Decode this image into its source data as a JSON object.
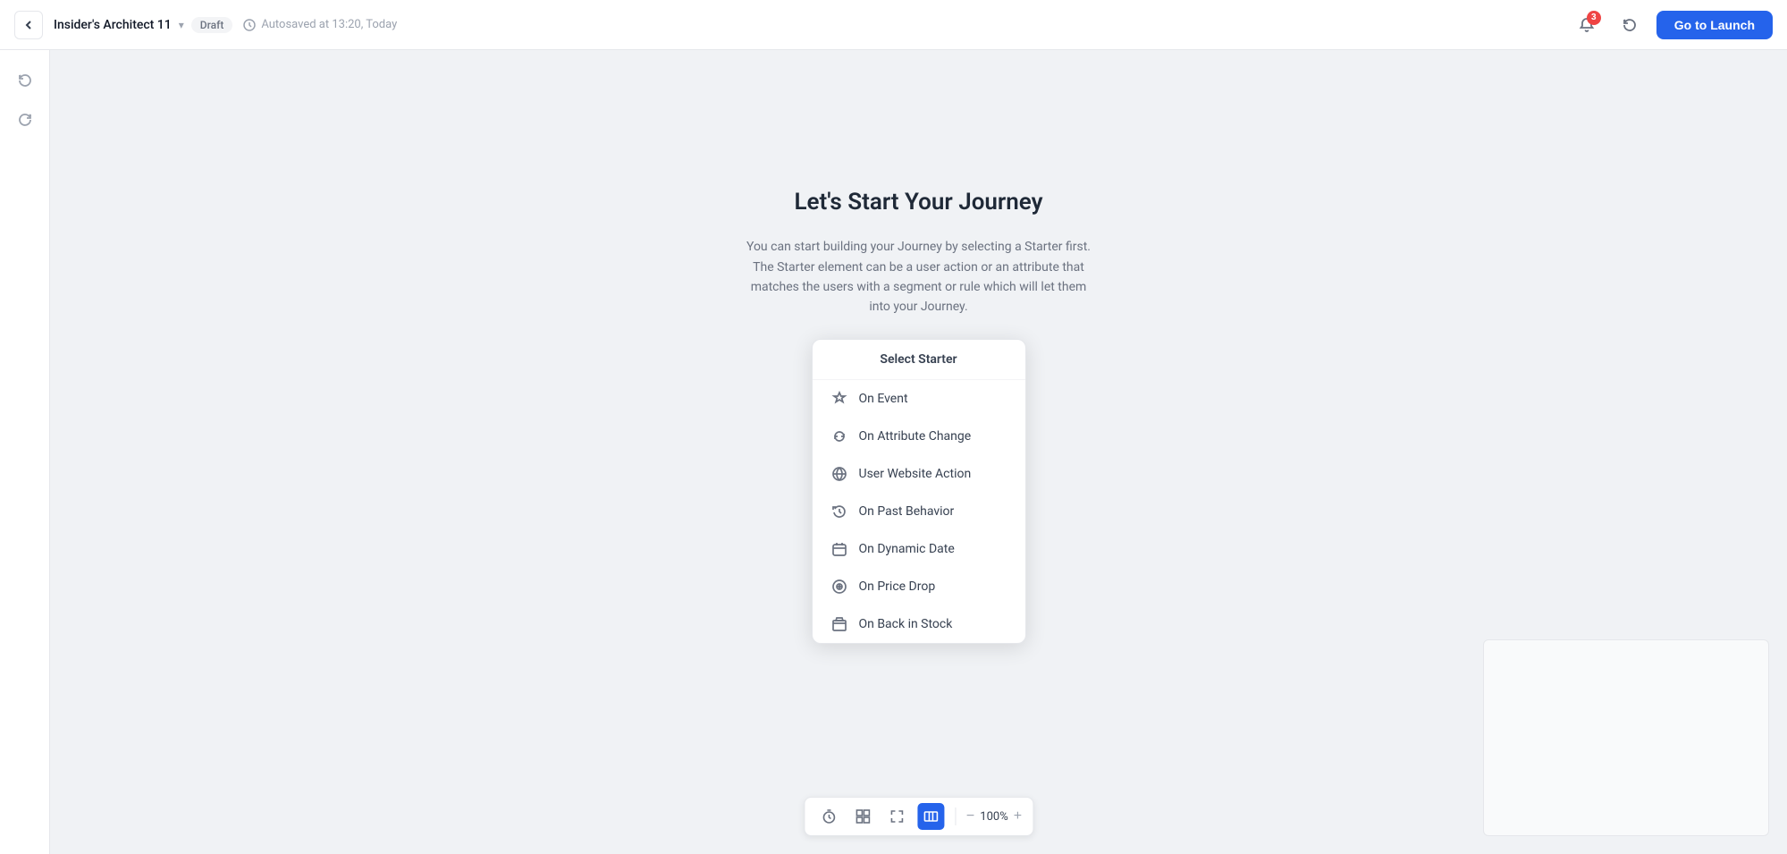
{
  "nav": {
    "back_label": "←",
    "title": "Insider's Architect 11",
    "chevron": "▾",
    "draft_badge": "Draft",
    "autosaved_text": "Autosaved at 13:20, Today",
    "history_icon": "🕐",
    "notification_icon": "🔔",
    "notification_count": "3",
    "undo_icon": "↺",
    "launch_btn": "Go to Launch"
  },
  "sidebar": {
    "undo_icon": "↩",
    "redo_icon": "↪"
  },
  "main": {
    "title": "Let's Start Your Journey",
    "description": "You can start building your Journey by selecting a Starter first. The Starter element can be a user action or an attribute that matches the users with a segment or rule which will let them into your Journey."
  },
  "starter_dropdown": {
    "header": "Select Starter",
    "items": [
      {
        "id": "on-event",
        "label": "On Event",
        "icon": "bell"
      },
      {
        "id": "on-attribute-change",
        "label": "On Attribute Change",
        "icon": "refresh"
      },
      {
        "id": "user-website-action",
        "label": "User Website Action",
        "icon": "globe"
      },
      {
        "id": "on-past-behavior",
        "label": "On Past Behavior",
        "icon": "cloud"
      },
      {
        "id": "on-dynamic-date",
        "label": "On Dynamic Date",
        "icon": "calendar"
      },
      {
        "id": "on-price-drop",
        "label": "On Price Drop",
        "icon": "tag"
      },
      {
        "id": "on-back-in-stock",
        "label": "On Back in Stock",
        "icon": "box"
      }
    ]
  },
  "toolbar": {
    "zoom_level": "100%",
    "minus_label": "−",
    "plus_label": "+"
  }
}
